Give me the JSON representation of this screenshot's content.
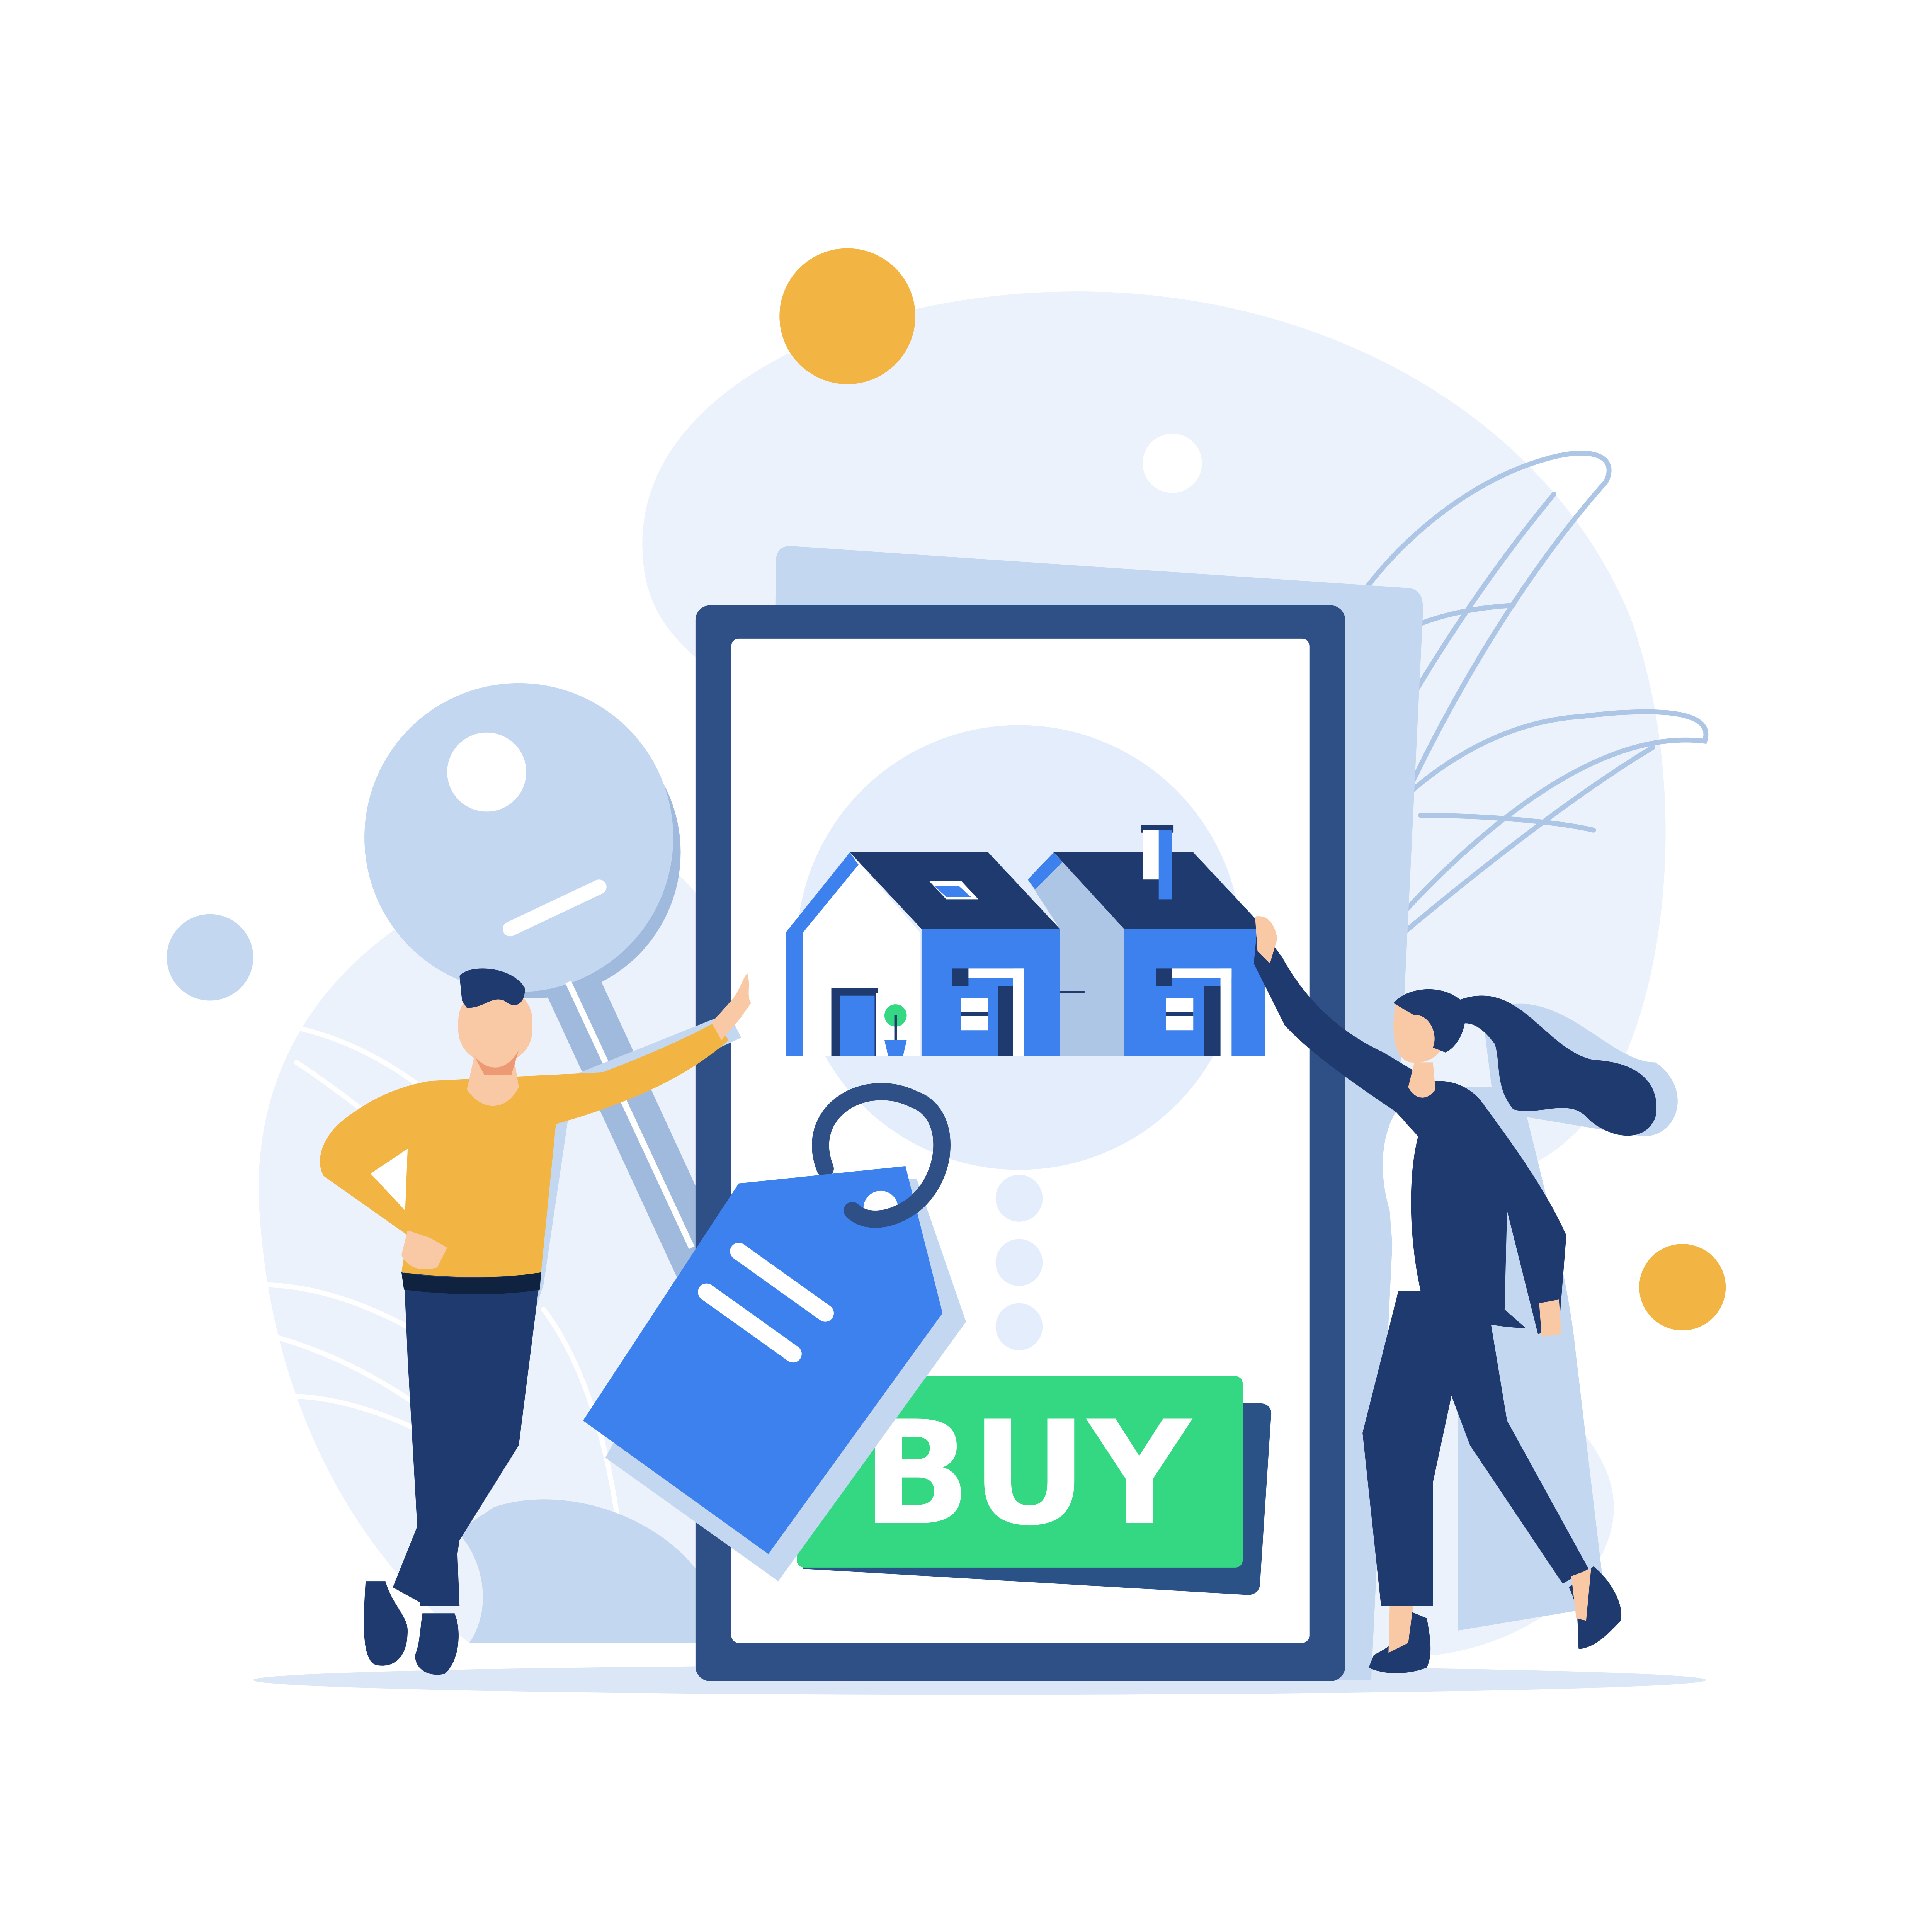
{
  "phone_screen": {
    "buy_button_label": "BUY"
  },
  "colors": {
    "background": "#ffffff",
    "backdrop_blob": "#ebf2fc",
    "light_blue": "#c4d7f0",
    "mid_blue": "#9fbadc",
    "phone_frame": "#2f5086",
    "navy": "#1f3a6e",
    "house_blue": "#3d81ef",
    "buy_green": "#34d883",
    "buy_green_shadow": "#2a5286",
    "orange": "#f2b443",
    "skin": "#f9c8a5",
    "ground": "#dbe6f7"
  },
  "icons": [
    "key-icon",
    "house-icon",
    "price-tag-icon",
    "leaf-icon"
  ]
}
